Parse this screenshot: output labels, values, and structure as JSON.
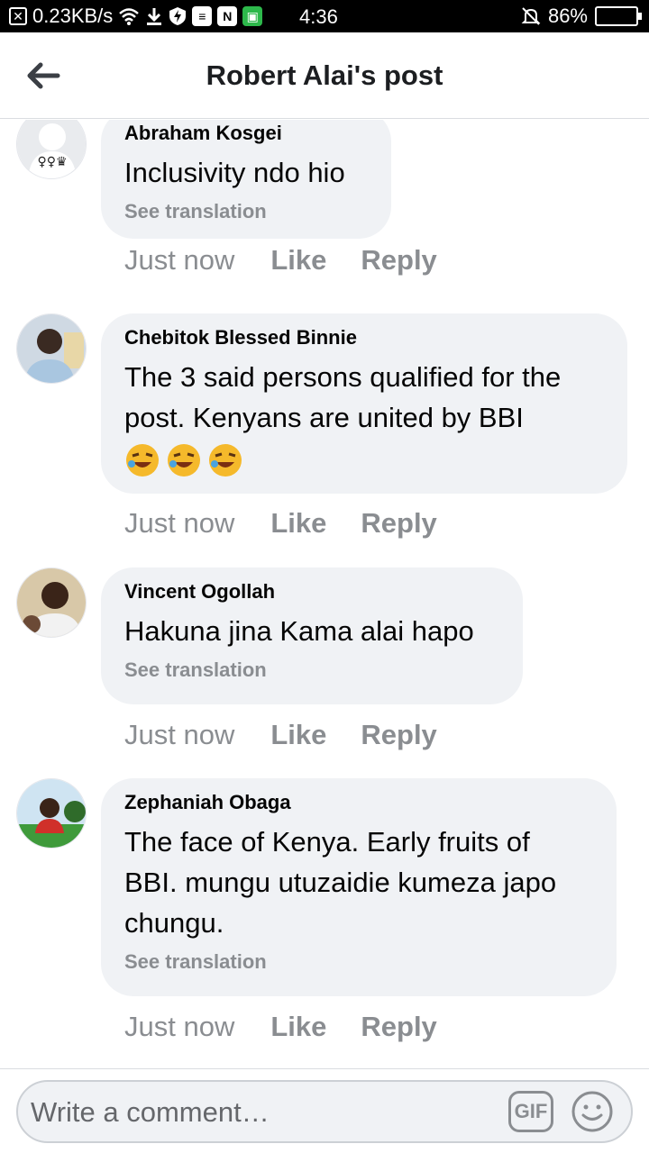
{
  "status_bar": {
    "net_speed": "0.23KB/s",
    "n_badge": "N",
    "time": "4:36",
    "battery": "86%",
    "battery_fraction": 0.86
  },
  "header": {
    "title": "Robert Alai's post",
    "back_icon": "arrow-left-icon"
  },
  "comments": [
    {
      "author": "Abraham Kosgei",
      "text": "Inclusivity ndo hio",
      "translate": "See translation",
      "time": "Just now",
      "like": "Like",
      "reply": "Reply"
    },
    {
      "author": "Chebitok Blessed Binnie",
      "text_lines": [
        "The 3 said persons qualified for the",
        "post. Kenyans are united by BBI"
      ],
      "emoji": [
        "rolling-on-floor-laughing",
        "rolling-on-floor-laughing",
        "rolling-on-floor-laughing"
      ],
      "time": "Just now",
      "like": "Like",
      "reply": "Reply"
    },
    {
      "author": "Vincent Ogollah",
      "text": "Hakuna jina Kama alai hapo",
      "translate": "See translation",
      "time": "Just now",
      "like": "Like",
      "reply": "Reply"
    },
    {
      "author": "Zephaniah Obaga",
      "text_lines": [
        "The face of Kenya. Early fruits of",
        "BBI. mungu utuzaidie kumeza japo",
        "chungu."
      ],
      "translate": "See translation",
      "time": "Just now",
      "like": "Like",
      "reply": "Reply"
    }
  ],
  "composer": {
    "placeholder": "Write a comment…",
    "gif_label": "GIF"
  },
  "colors": {
    "bubble": "#f0f2f5",
    "muted": "#8a8d91",
    "text": "#050505"
  }
}
